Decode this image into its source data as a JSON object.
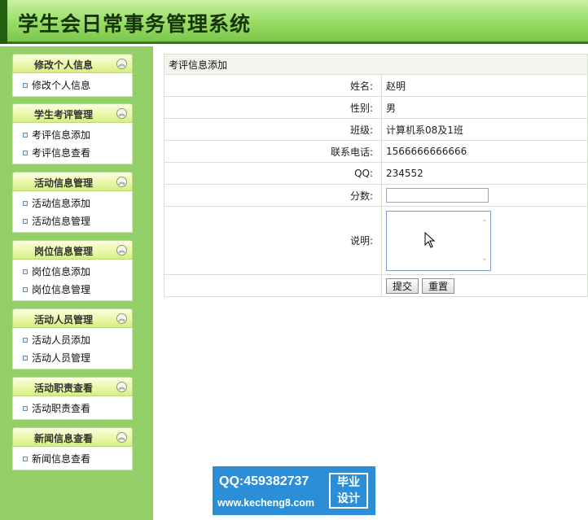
{
  "app": {
    "title": "学生会日常事务管理系统"
  },
  "sidebar": {
    "groups": [
      {
        "title": "修改个人信息",
        "items": [
          "修改个人信息"
        ]
      },
      {
        "title": "学生考评管理",
        "items": [
          "考评信息添加",
          "考评信息查看"
        ]
      },
      {
        "title": "活动信息管理",
        "items": [
          "活动信息添加",
          "活动信息管理"
        ]
      },
      {
        "title": "岗位信息管理",
        "items": [
          "岗位信息添加",
          "岗位信息管理"
        ]
      },
      {
        "title": "活动人员管理",
        "items": [
          "活动人员添加",
          "活动人员管理"
        ]
      },
      {
        "title": "活动职责查看",
        "items": [
          "活动职责查看"
        ]
      },
      {
        "title": "新闻信息查看",
        "items": [
          "新闻信息查看"
        ]
      }
    ]
  },
  "form": {
    "caption": "考评信息添加",
    "rows": [
      {
        "label": "姓名:",
        "value": "赵明"
      },
      {
        "label": "性别:",
        "value": "男"
      },
      {
        "label": "班级:",
        "value": "计算机系08及1班"
      },
      {
        "label": "联系电话:",
        "value": "1566666666666"
      },
      {
        "label": "QQ:",
        "value": "234552"
      }
    ],
    "score_label": "分数:",
    "score_value": "",
    "desc_label": "说明:",
    "desc_value": "",
    "submit_label": "提交",
    "reset_label": "重置"
  },
  "watermark": {
    "qq": "QQ:459382737",
    "site": "www.kecheng8.com",
    "line1": "毕业",
    "line2": "设计"
  },
  "colors": {
    "header_green": "#9bde69",
    "sidebar_green": "#93cf68",
    "watermark_blue": "#2b8ed6"
  }
}
